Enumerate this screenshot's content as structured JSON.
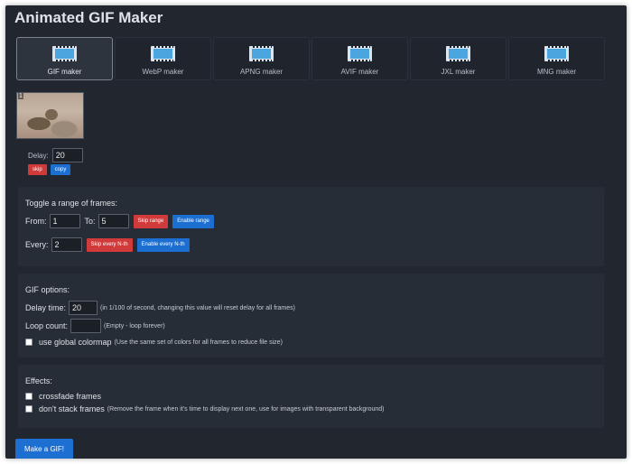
{
  "app": {
    "title": "Animated GIF Maker"
  },
  "tabs": [
    {
      "label": "GIF maker",
      "active": true,
      "icon": "film-strip-icon"
    },
    {
      "label": "WebP maker",
      "active": false,
      "icon": "film-strip-icon"
    },
    {
      "label": "APNG maker",
      "active": false,
      "icon": "film-strip-icon"
    },
    {
      "label": "AVIF maker",
      "active": false,
      "icon": "film-strip-icon"
    },
    {
      "label": "JXL maker",
      "active": false,
      "icon": "film-strip-icon"
    },
    {
      "label": "MNG maker",
      "active": false,
      "icon": "film-strip-icon"
    }
  ],
  "frame": {
    "number": "1",
    "delay_label": "Delay:",
    "delay_value": "20",
    "skip_label": "skip",
    "copy_label": "copy"
  },
  "range": {
    "heading": "Toggle a range of frames:",
    "from_label": "From:",
    "from_value": "1",
    "to_label": "To:",
    "to_value": "5",
    "skip_range_label": "Skip range",
    "enable_range_label": "Enable range",
    "every_label": "Every:",
    "every_value": "2",
    "skip_nth_label": "Skip every N-th",
    "enable_nth_label": "Enable every N-th"
  },
  "gif_options": {
    "heading": "GIF options:",
    "delay_label": "Delay time:",
    "delay_value": "20",
    "delay_note": "(in 1/100 of second, changing this value will reset delay for all frames)",
    "loop_label": "Loop count:",
    "loop_value": "",
    "loop_note": "(Empty - loop forever)",
    "colormap_label": "use global colormap",
    "colormap_note": "(Use the same set of colors for all frames to reduce file size)"
  },
  "effects": {
    "heading": "Effects:",
    "crossfade_label": "crossfade frames",
    "nostack_label": "don't stack frames",
    "nostack_note": "(Remove the frame when it's time to display next one, use for images with transparent background)"
  },
  "submit": {
    "label": "Make a GIF!"
  },
  "colors": {
    "background": "#21262f",
    "panel": "#272d36",
    "danger": "#d03a3a",
    "primary": "#1c6fd1"
  }
}
